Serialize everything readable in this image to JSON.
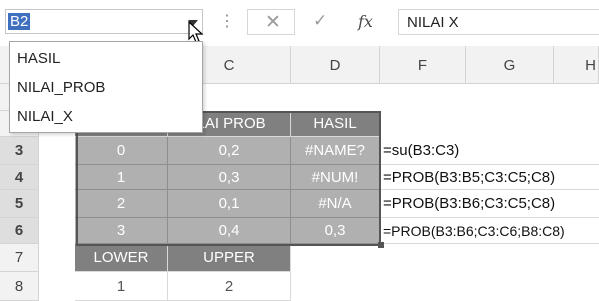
{
  "formula_bar": {
    "name_box_value": "B2",
    "fx_label": "fx",
    "formula_value": "NILAI X",
    "icons": {
      "dropdown": "chevron-down-icon",
      "cancel": "close-icon",
      "enter": "check-icon",
      "insert_function": "fx-icon",
      "cursor": "mouse-cursor-icon"
    }
  },
  "name_dropdown": {
    "items": [
      "HASIL",
      "NILAI_PROB",
      "NILAI_X"
    ]
  },
  "columns": [
    "C",
    "D",
    "F",
    "G",
    "H"
  ],
  "rows": [
    "3",
    "4",
    "5",
    "6",
    "7",
    "8"
  ],
  "table": {
    "headers": [
      "ILAI PROB",
      "HASIL"
    ],
    "rows": [
      {
        "x": "0",
        "prob": "0,2",
        "hasil": "#NAME?",
        "formula": "=su(B3:C3)"
      },
      {
        "x": "1",
        "prob": "0,3",
        "hasil": "#NUM!",
        "formula": "=PROB(B3:B5;C3:C5;C8)"
      },
      {
        "x": "2",
        "prob": "0,1",
        "hasil": "#N/A",
        "formula": "=PROB(B3:B6;C3:C5;C8)"
      },
      {
        "x": "3",
        "prob": "0,4",
        "hasil": "0,3",
        "formula": "=PROB(B3:B6;C3:C6;B8:C8)"
      }
    ]
  },
  "bounds": {
    "labels": [
      "LOWER",
      "UPPER"
    ],
    "values": [
      "1",
      "2"
    ]
  },
  "colors": {
    "header_fill": "#808080",
    "data_fill": "#b0b0b0",
    "selection": "#3f6fbf"
  }
}
